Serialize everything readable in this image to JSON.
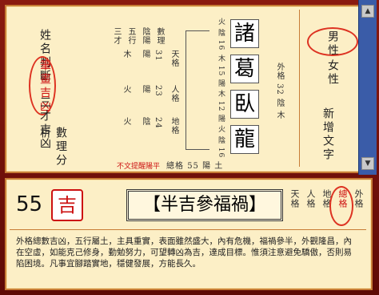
{
  "menu": {
    "items": [
      "姓名判斷",
      "筆畫吉凶",
      "三才吉凶",
      "數理分析"
    ],
    "options": [
      "男性",
      "女性"
    ],
    "new_text": "新增文字",
    "footer": "不文提醒陽平"
  },
  "name": {
    "chars": [
      "諸",
      "葛",
      "臥",
      "龍"
    ],
    "ann": [
      "火 陰 16",
      "木 15 陽",
      "木 12 陽",
      "火 陰 16"
    ],
    "outer": "外格 32 陰 木"
  },
  "grids": {
    "tian": {
      "label": "天格",
      "num": "31",
      "yy": "陽",
      "elem": "木"
    },
    "ren": {
      "label": "人格",
      "num": "23",
      "yy": "陽",
      "elem": "火"
    },
    "di": {
      "label": "地格",
      "num": "24",
      "yy": "陰",
      "elem": "火"
    },
    "total": {
      "label": "總格",
      "num": "55",
      "yy": "陽",
      "elem": "土"
    },
    "headers": [
      "數理",
      "陰陽",
      "五行",
      "三才"
    ]
  },
  "result": {
    "score": "55",
    "luck": "吉",
    "title": "【半吉參福禍】",
    "tags": [
      "天格",
      "人格",
      "地格",
      "總格",
      "外格"
    ],
    "text": "外格總數吉凶，五行屬土，主具重實，表面雖然盛大，內有危機，福禍參半，外觀隆昌，內在空虛，如能克己修身，勤勉努力，可望轉凶為吉，達成目標。惟須注意避免驕傲，否則易陷困境。凡事宜腳踏實地，穩健發展，方能長久。"
  },
  "colors": {
    "accent": "#c11111",
    "paper": "#fcefc6",
    "frame": "#7a0f08"
  }
}
